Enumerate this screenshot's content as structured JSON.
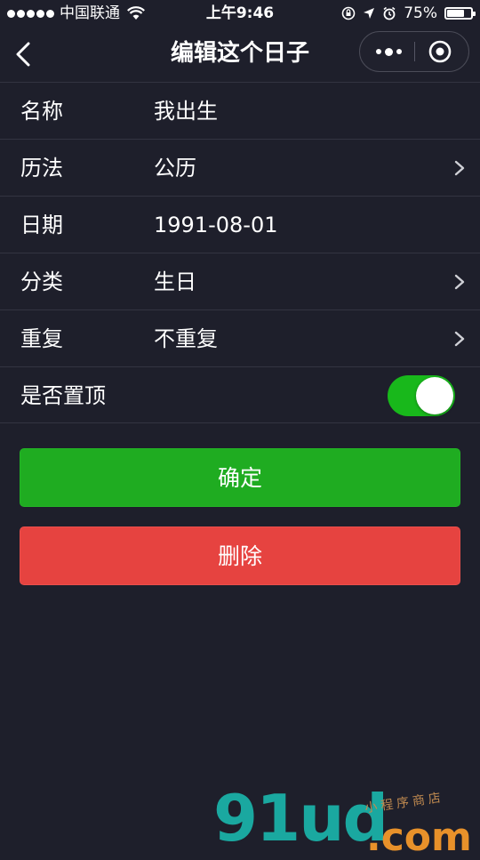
{
  "status_bar": {
    "carrier": "中国联通",
    "time": "上午9:46",
    "battery_percent": "75%",
    "battery_level": 0.75
  },
  "nav": {
    "title": "编辑这个日子"
  },
  "form": {
    "rows": [
      {
        "label": "名称",
        "value": "我出生",
        "has_chevron": false
      },
      {
        "label": "历法",
        "value": "公历",
        "has_chevron": true
      },
      {
        "label": "日期",
        "value": "1991-08-01",
        "has_chevron": false
      },
      {
        "label": "分类",
        "value": "生日",
        "has_chevron": true
      },
      {
        "label": "重复",
        "value": "不重复",
        "has_chevron": true
      }
    ],
    "pin": {
      "label": "是否置顶",
      "on": true
    }
  },
  "buttons": {
    "confirm": "确定",
    "delete": "删除"
  },
  "watermark": {
    "main": "91ud",
    "dot_com": ".com",
    "subtitle": "小程序商店"
  },
  "colors": {
    "background": "#1e1f2b",
    "confirm": "#1fac21",
    "delete": "#e64340",
    "switch_on": "#18b81b"
  }
}
